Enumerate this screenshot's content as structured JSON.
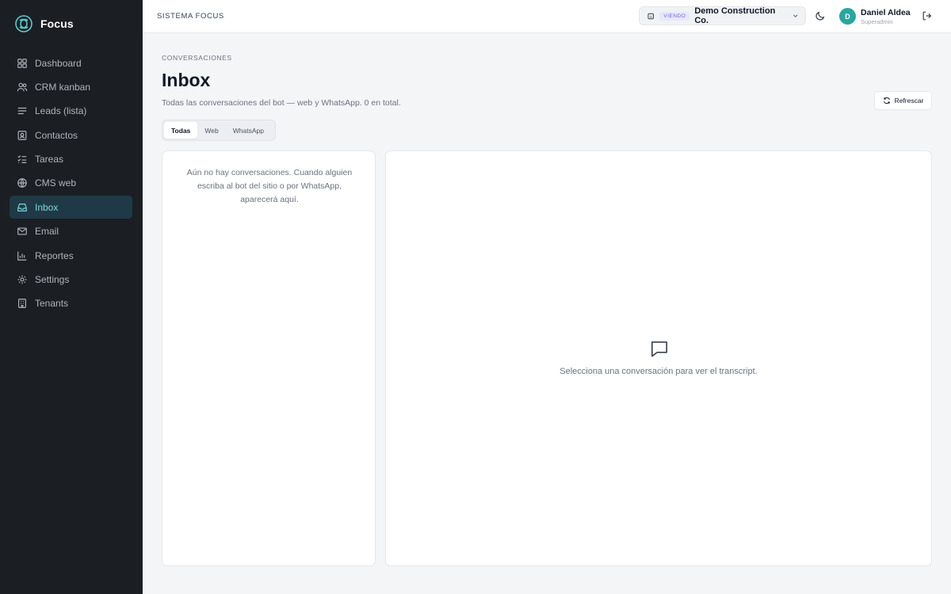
{
  "sidebar": {
    "brand": "Focus",
    "items": [
      {
        "label": "Dashboard",
        "icon": "dashboard-icon"
      },
      {
        "label": "CRM kanban",
        "icon": "users-icon"
      },
      {
        "label": "Leads (lista)",
        "icon": "list-icon"
      },
      {
        "label": "Contactos",
        "icon": "contact-icon"
      },
      {
        "label": "Tareas",
        "icon": "tasks-icon"
      },
      {
        "label": "CMS web",
        "icon": "globe-icon"
      },
      {
        "label": "Inbox",
        "icon": "inbox-icon",
        "active": true
      },
      {
        "label": "Email",
        "icon": "mail-icon"
      },
      {
        "label": "Reportes",
        "icon": "chart-icon"
      },
      {
        "label": "Settings",
        "icon": "gear-icon"
      },
      {
        "label": "Tenants",
        "icon": "building-icon"
      }
    ]
  },
  "header": {
    "system_title": "SISTEMA FOCUS",
    "tenant_badge": "VIENDO",
    "tenant_name": "Demo Construction Co.",
    "user_initial": "D",
    "user_name": "Daniel Aldea",
    "user_role": "Superadmin"
  },
  "main": {
    "breadcrumb": "CONVERSACIONES",
    "title": "Inbox",
    "subtitle": "Todas las conversaciones del bot — web y WhatsApp. 0 en total.",
    "refresh_label": "Refrescar",
    "tabs": [
      {
        "label": "Todas",
        "active": true
      },
      {
        "label": "Web"
      },
      {
        "label": "WhatsApp"
      }
    ],
    "empty_list": "Aún no hay conversaciones. Cuando alguien escriba al bot del sitio o por WhatsApp, aparecerá aquí.",
    "empty_detail": "Selecciona una conversación para ver el transcript."
  },
  "colors": {
    "sidebar_bg": "#1b1f24",
    "active_item_bg": "#1f3a46",
    "active_item_text": "#7dd3e0",
    "brand_accent": "#5ec8cf",
    "avatar_bg": "#2aa5a0",
    "badge_text": "#6d63d8"
  }
}
